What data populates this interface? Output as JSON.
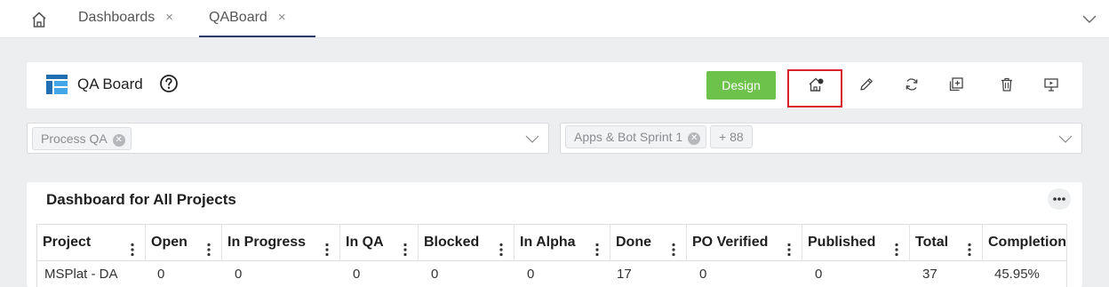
{
  "tabs": [
    {
      "label": "Dashboards",
      "close": "×"
    },
    {
      "label": "QABoard",
      "close": "×"
    }
  ],
  "header": {
    "title": "QA Board",
    "design_label": "Design",
    "toolbar_icons": [
      "home-settings-icon",
      "edit-icon",
      "refresh-icon",
      "duplicate-icon",
      "delete-icon",
      "present-icon"
    ],
    "highlight_color": "#d8232a",
    "design_color": "#6cc24a"
  },
  "filters": {
    "left": {
      "chips": [
        "Process QA"
      ]
    },
    "right": {
      "chips": [
        "Apps & Bot Sprint 1"
      ],
      "more": "+ 88"
    }
  },
  "table": {
    "title": "Dashboard for All Projects",
    "columns": [
      "Project",
      "Open",
      "In Progress",
      "In QA",
      "Blocked",
      "In Alpha",
      "Done",
      "PO Verified",
      "Published",
      "Total",
      "Completion"
    ],
    "rows": [
      [
        "MSPlat - DA",
        "0",
        "0",
        "0",
        "0",
        "0",
        "17",
        "0",
        "0",
        "37",
        "45.95%"
      ]
    ]
  }
}
